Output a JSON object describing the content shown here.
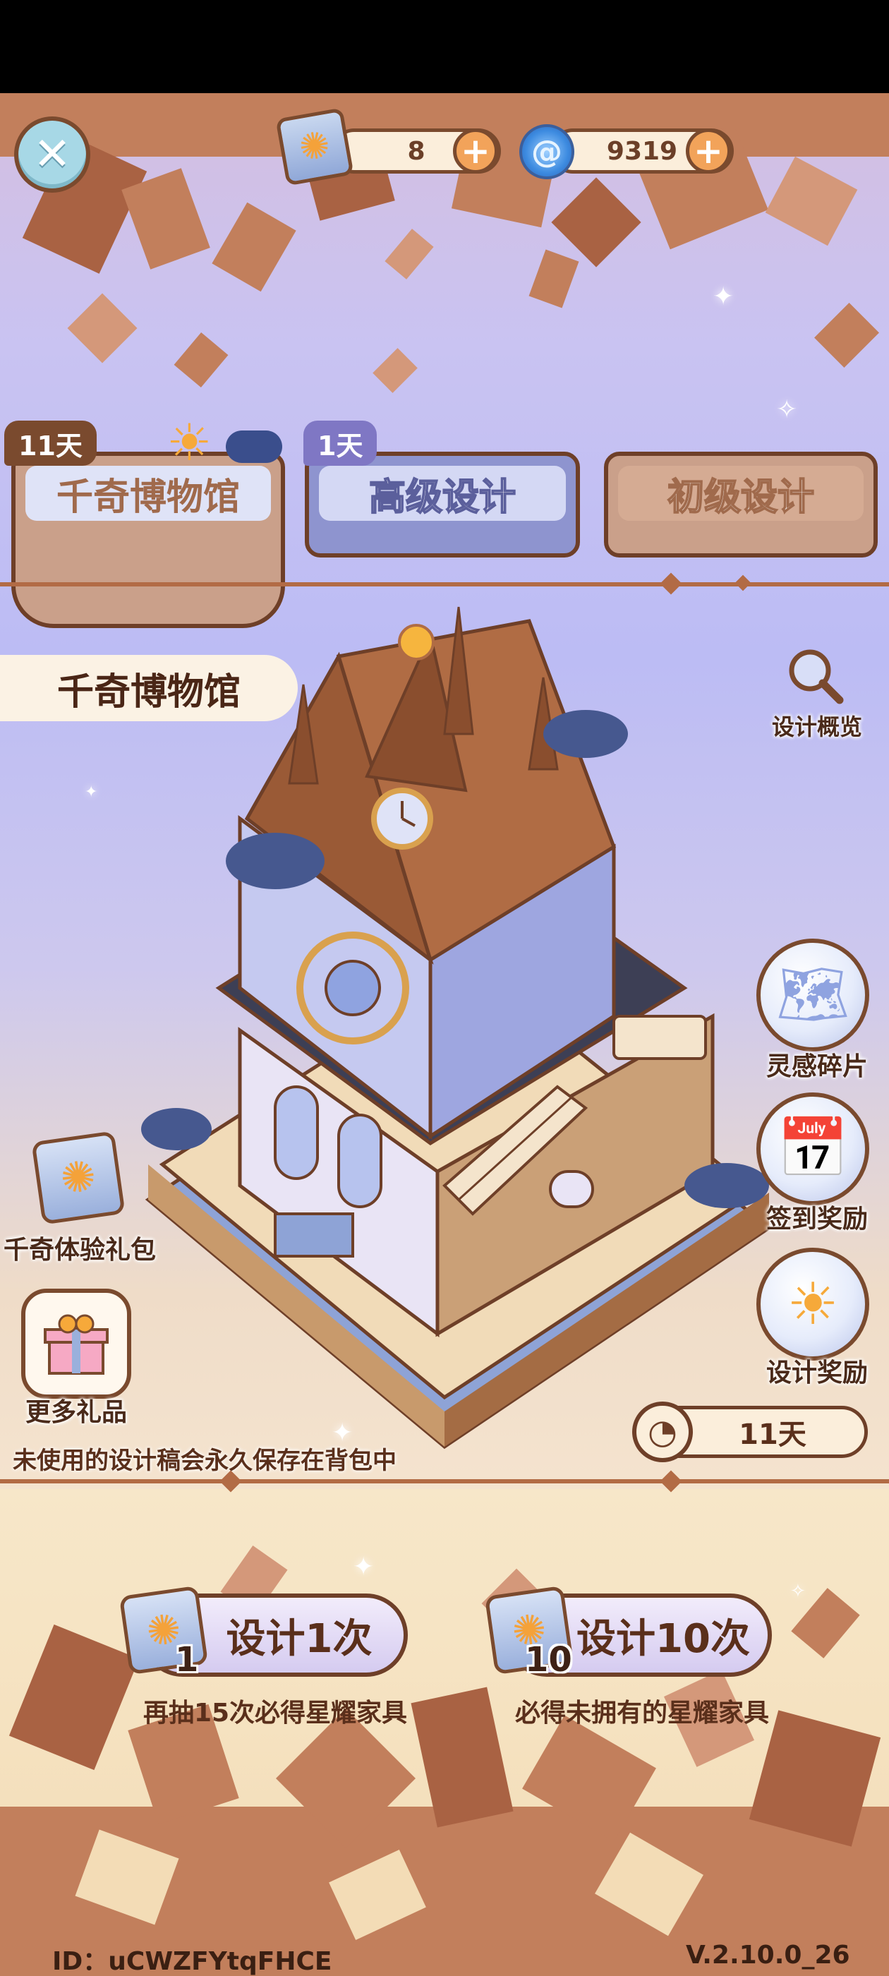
{
  "topbar": {
    "close_icon": "close-icon",
    "currencies": [
      {
        "icon": "design-scroll-icon",
        "value": "8"
      },
      {
        "icon": "swirl-gem-icon",
        "value": "9319"
      }
    ]
  },
  "tabs": [
    {
      "label": "千奇博物馆",
      "days": "11天",
      "active": true
    },
    {
      "label": "高级设计",
      "days": "1天",
      "active": false
    },
    {
      "label": "初级设计",
      "days": "",
      "active": false
    }
  ],
  "exhibit": {
    "title": "千奇博物馆",
    "overview_label": "设计概览"
  },
  "side_buttons": [
    {
      "label": "灵感碎片",
      "icon": "map-fragment-icon"
    },
    {
      "label": "签到奖励",
      "icon": "calendar-icon"
    },
    {
      "label": "设计奖励",
      "icon": "sun-medal-icon"
    }
  ],
  "gifts": {
    "trial_pack_label": "千奇体验礼包",
    "more_gifts_label": "更多礼品"
  },
  "notice": "未使用的设计稿会永久保存在背包中",
  "timer": {
    "value": "11天"
  },
  "draws": [
    {
      "label": "设计1次",
      "count": "1",
      "hint": "再抽15次必得星耀家具"
    },
    {
      "label": "设计10次",
      "count": "10",
      "hint": "必得未拥有的星耀家具"
    }
  ],
  "footer": {
    "id_text": "ID：uCWZFYtqFHCE",
    "version": "V.2.10.0_26"
  },
  "colors": {
    "brown": "#6e3f28",
    "accent_orange": "#f2a35a",
    "tab_active_bg": "#caa08a",
    "tab_mid_bg": "#8e94cf",
    "tab_right_bg": "#caa08a"
  }
}
